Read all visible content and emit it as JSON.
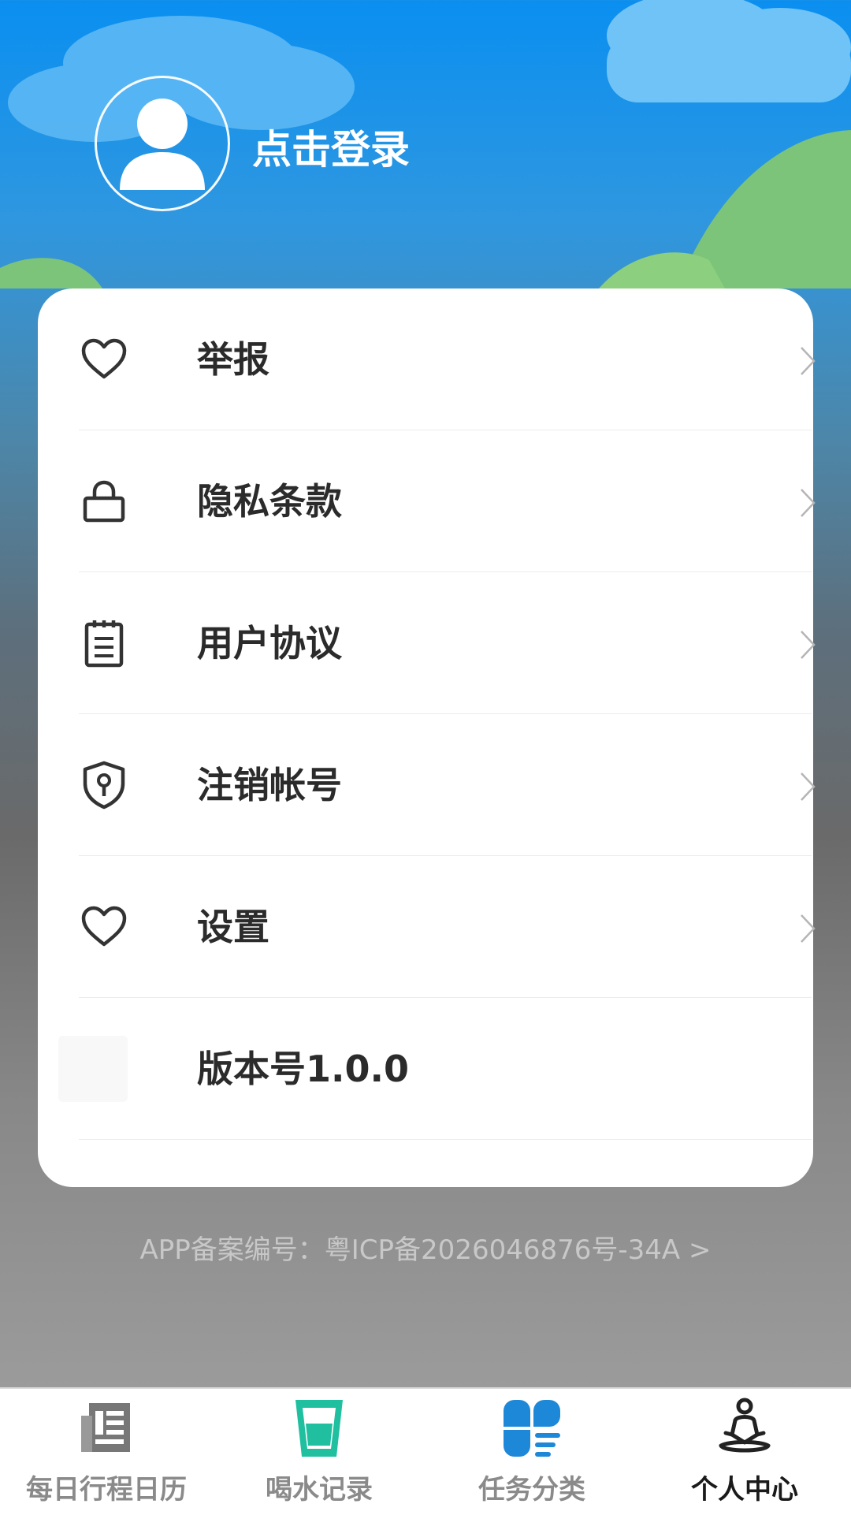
{
  "header": {
    "login_label": "点击登录"
  },
  "menu": {
    "items": [
      {
        "label": "举报",
        "icon": "heart-icon"
      },
      {
        "label": "隐私条款",
        "icon": "lock-icon"
      },
      {
        "label": "用户协议",
        "icon": "document-icon"
      },
      {
        "label": "注销帐号",
        "icon": "shield-key-icon"
      },
      {
        "label": "设置",
        "icon": "heart-icon"
      }
    ],
    "version_label": "版本号1.0.0"
  },
  "footer": {
    "icp_text": "APP备案编号：粤ICP备2026046876号-34A >"
  },
  "tabbar": {
    "tabs": [
      {
        "label": "每日行程日历",
        "icon": "calendar-icon",
        "active": false
      },
      {
        "label": "喝水记录",
        "icon": "water-cup-icon",
        "active": false
      },
      {
        "label": "任务分类",
        "icon": "category-icon",
        "active": false
      },
      {
        "label": "个人中心",
        "icon": "meditation-person-icon",
        "active": true
      }
    ]
  },
  "colors": {
    "sky_top": "#0a8ff0",
    "card_bg": "#ffffff",
    "text_dark": "#2b2b2b",
    "tab_inactive": "#8a8a8a",
    "tab_active": "#1a1a1a",
    "water_icon": "#1fbfa0",
    "category_icon": "#1e88d8"
  }
}
